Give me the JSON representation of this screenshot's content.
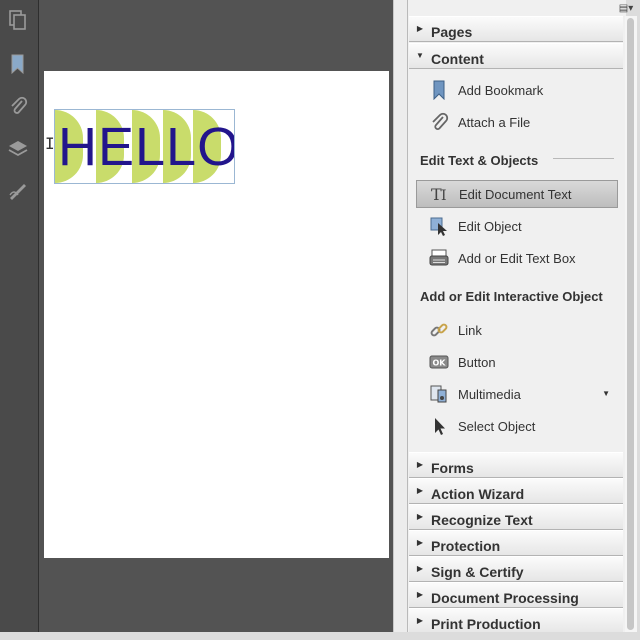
{
  "document": {
    "text": "HELLO",
    "colors": {
      "text": "#22158c",
      "shape_fill": "#c9dc6b",
      "selection_border": "#9bb7d3"
    }
  },
  "left_rail": {
    "icons": [
      "pages-icon",
      "bookmark-icon",
      "paperclip-icon",
      "layers-icon",
      "signature-icon"
    ]
  },
  "pane": {
    "headers_top": [
      {
        "label": "Pages",
        "expanded": false
      },
      {
        "label": "Content",
        "expanded": true
      }
    ],
    "content": {
      "items_a": [
        {
          "label": "Add Bookmark",
          "icon": "bookmark-add-icon"
        },
        {
          "label": "Attach a File",
          "icon": "paperclip-icon"
        }
      ],
      "group_edit_text": "Edit Text & Objects",
      "items_b": [
        {
          "label": "Edit Document Text",
          "icon": "edit-text-icon",
          "selected": true
        },
        {
          "label": "Edit Object",
          "icon": "edit-object-icon"
        },
        {
          "label": "Add or Edit Text Box",
          "icon": "typewriter-icon"
        }
      ],
      "group_interactive": "Add or Edit Interactive Object",
      "items_c": [
        {
          "label": "Link",
          "icon": "link-icon"
        },
        {
          "label": "Button",
          "icon": "ok-button-icon",
          "icon_text": "OK"
        },
        {
          "label": "Multimedia",
          "icon": "multimedia-icon",
          "has_dropdown": true
        },
        {
          "label": "Select Object",
          "icon": "arrow-cursor-icon"
        }
      ]
    },
    "headers_bottom": [
      {
        "label": "Forms"
      },
      {
        "label": "Action Wizard"
      },
      {
        "label": "Recognize Text"
      },
      {
        "label": "Protection"
      },
      {
        "label": "Sign & Certify"
      },
      {
        "label": "Document Processing"
      },
      {
        "label": "Print Production"
      }
    ]
  }
}
